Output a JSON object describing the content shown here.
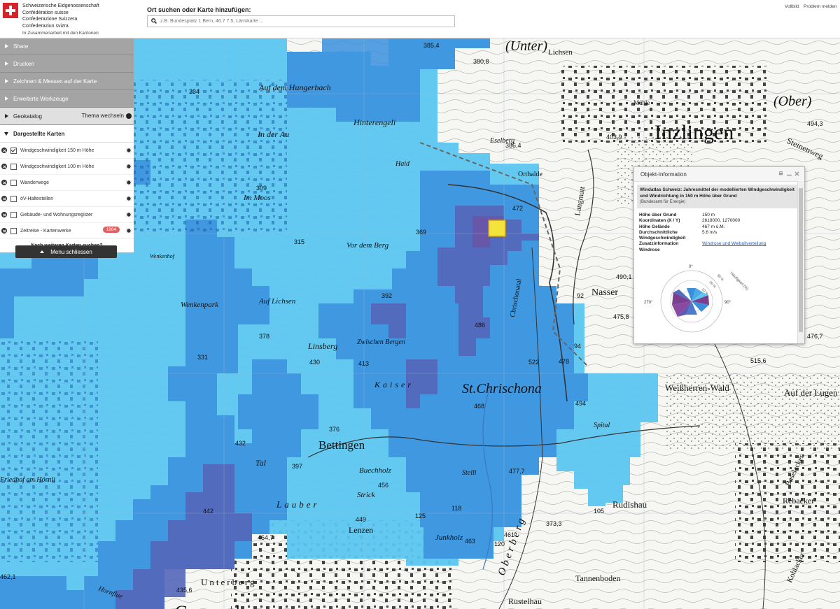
{
  "header": {
    "org_lines": [
      "Schweizerische Eidgenossenschaft",
      "Confédération suisse",
      "Confederazione Svizzera",
      "Confederaziun svizra"
    ],
    "org_tagline": "In Zusammenarbeit mit den Kantonen",
    "search_title": "Ort suchen oder Karte hinzufügen:",
    "search_placeholder": "z.B. Bundesplatz 1 Bern, 46.7 7.5, Lärmkarte ...",
    "links": [
      "Vollbild",
      "Problem melden"
    ]
  },
  "sidebar": {
    "menu_items": [
      "Share",
      "Drucken",
      "Zeichnen & Messen auf der Karte",
      "Erweiterte Werkzeuge"
    ],
    "geokatalog": "Geokatalog",
    "theme_switch": "Thema wechseln",
    "layers_title": "Dargestellte Karten",
    "layers": [
      {
        "label": "Windgeschwindigkeit 150 m Höhe",
        "checked": true
      },
      {
        "label": "Windgeschwindigkeit 100 m Höhe",
        "checked": false
      },
      {
        "label": "Wanderwege",
        "checked": false
      },
      {
        "label": "öV-Haltestellen",
        "checked": false
      },
      {
        "label": "Gebäude- und Wohnungsregister",
        "checked": false
      },
      {
        "label": "Zeitreise - Kartenwerke",
        "checked": false,
        "badge": "1864"
      }
    ],
    "more_maps": "Nach weiteren Karten suchen?",
    "close_menu": "Menu schliessen"
  },
  "info": {
    "title": "Objekt-Information",
    "layer_title": "Windatlas Schweiz: Jahresmittel der modellierten Windgeschwindigkeit und Windrichtung in 150 m Höhe über Grund",
    "source": "(Bundesamt für Energie)",
    "rows": [
      {
        "key": "Höhe über Grund",
        "value": "150 m"
      },
      {
        "key": "Koordinaten (X / Y)",
        "value": "2618000, 1270000"
      },
      {
        "key": "Höhe Gelände",
        "value": "467 m ü.M."
      },
      {
        "key": "Durchschnittliche",
        "value": "5.6 m/s"
      },
      {
        "key": "Windgeschwindigkeit",
        "value": ""
      },
      {
        "key": "Zusatzinformation",
        "value": "Windrose und Weibullverteilung",
        "link": true
      },
      {
        "key": "Windrose",
        "value": ""
      }
    ],
    "windrose": {
      "north": "0°",
      "east": "90°",
      "west": "270°",
      "axis_title": "Häufigkeit (%)",
      "rings": [
        "10 %",
        "20 %",
        "30 %"
      ]
    }
  },
  "map_labels": {
    "places": [
      "(Unter)",
      "(Ober)",
      "Inzlingen",
      "Steinenweg",
      "Auf dem Hungerbach",
      "Hinterengeli",
      "In der Au",
      "Im Moos",
      "Orthalde",
      "Langmatt",
      "Vor dem Berg",
      "Chrischonatal",
      "Wenkenpark",
      "Auf Lichsen",
      "Linsberg",
      "Zwischen Bergen",
      "Kaiser",
      "St.Chrischona",
      "Nasser",
      "Weißherren-Wald",
      "Auf der Lugen",
      "Bettingen",
      "Buechholz",
      "Strick",
      "Tal",
      "Lauber",
      "Spital",
      "Rudishau",
      "Rebacker",
      "Baselacker",
      "Kohlacker",
      "Lenzen",
      "Junkholz",
      "Unterberg",
      "Tannenboden",
      "Rustelhau",
      "Grenzach",
      "Hornflue",
      "Friedhof am Hörnli",
      "Lichsen",
      "Mühle",
      "Oberberg",
      "Stelli",
      "Wenkenhof",
      "Eselberg",
      "Haid"
    ],
    "heights": [
      "385,4",
      "380,8",
      "386,4",
      "403,9",
      "494,3",
      "490,1",
      "475,8",
      "476,7",
      "515,6",
      "477,7",
      "373,3",
      "464,7",
      "435,6",
      "462,1",
      "472",
      "369",
      "315",
      "309",
      "392",
      "378",
      "331",
      "430",
      "413",
      "376",
      "397",
      "442",
      "432",
      "456",
      "449",
      "125",
      "118",
      "463",
      "120",
      "468",
      "522",
      "494",
      "486",
      "461",
      "478",
      "92",
      "94",
      "105",
      "234"
    ]
  },
  "colors": {
    "wind_low": "#5cc6f0",
    "wind_mid": "#3a8fdd",
    "wind_high": "#5466b8",
    "wind_max": "#6a55a6",
    "selection": "#f3e33c"
  }
}
